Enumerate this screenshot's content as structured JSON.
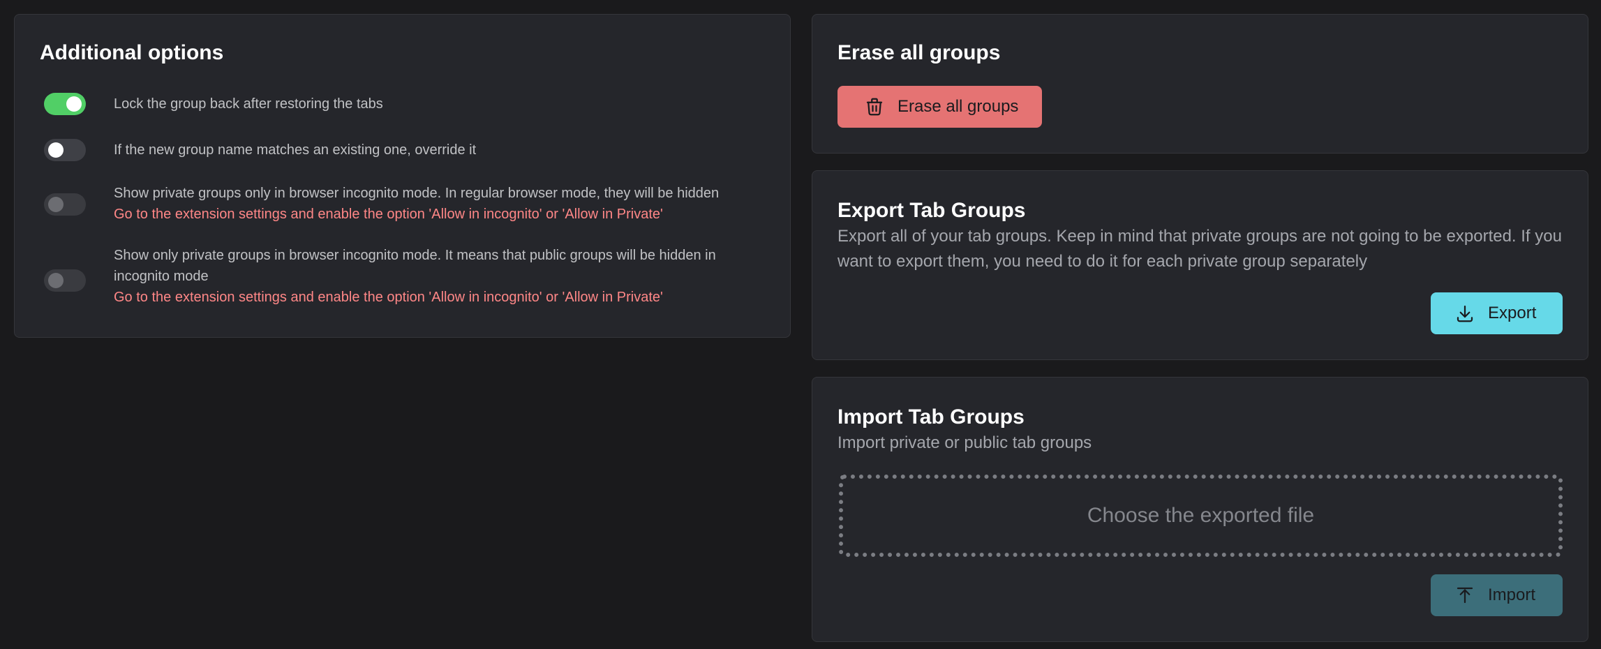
{
  "additional_options": {
    "title": "Additional options",
    "options": [
      {
        "label": "Lock the group back after restoring the tabs",
        "enabled": true,
        "warning": ""
      },
      {
        "label": "If the new group name matches an existing one, override it",
        "enabled": false,
        "warning": ""
      },
      {
        "label": "Show private groups only in browser incognito mode. In regular browser mode, they will be hidden",
        "enabled": false,
        "disabled": true,
        "warning": "Go to the extension settings and enable the option 'Allow in incognito' or 'Allow in Private'"
      },
      {
        "label": "Show only private groups in browser incognito mode. It means that public groups will be hidden in incognito mode",
        "enabled": false,
        "disabled": true,
        "warning": "Go to the extension settings and enable the option 'Allow in incognito' or 'Allow in Private'"
      }
    ]
  },
  "erase": {
    "title": "Erase all groups",
    "button_label": "Erase all groups",
    "button_icon": "trash-icon",
    "button_color": "#e57373"
  },
  "export": {
    "title": "Export Tab Groups",
    "description": "Export all of your tab groups. Keep in mind that private groups are not going to be exported. If you want to export them, you need to do it for each private group separately",
    "button_label": "Export",
    "button_icon": "download-icon",
    "button_color": "#66d9e8"
  },
  "import": {
    "title": "Import Tab Groups",
    "description": "Import private or public tab groups",
    "dropzone_label": "Choose the exported file",
    "button_label": "Import",
    "button_icon": "upload-icon",
    "button_color": "#3c6e7a"
  },
  "colors": {
    "background": "#1a1a1c",
    "card": "#25262b",
    "toggle_on": "#51cf66",
    "warning": "#ff8787"
  }
}
